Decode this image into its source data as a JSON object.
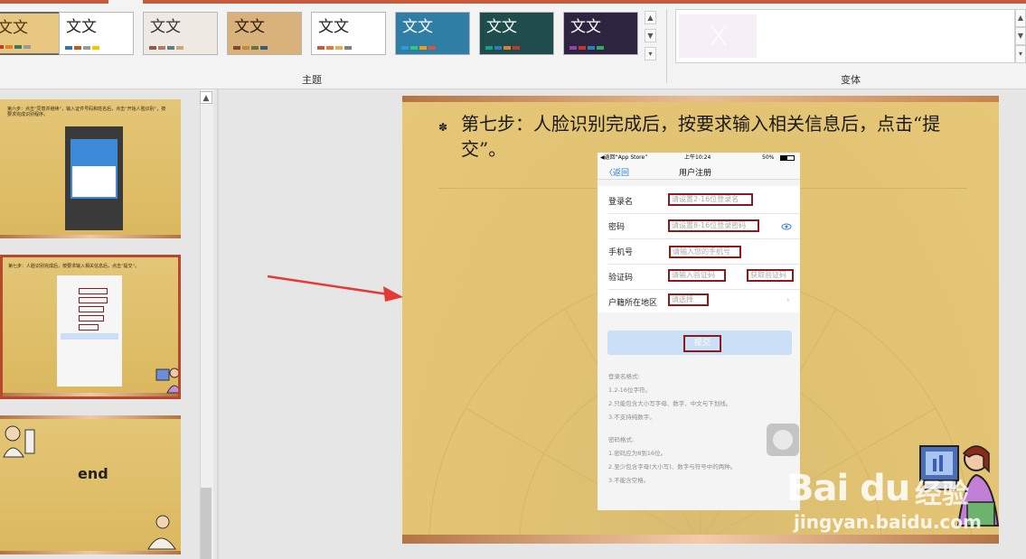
{
  "ribbon": {
    "themes": [
      {
        "label": "文文",
        "bg": "#e8c880",
        "color": "#4a3310",
        "bars": [
          "#c0392b",
          "#e67e22",
          "#3b7a57",
          "#999999"
        ]
      },
      {
        "label": "文文",
        "bg": "#ffffff",
        "color": "#222222",
        "bars": [
          "#2e75b6",
          "#c55a11",
          "#999999",
          "#ffc000"
        ]
      },
      {
        "label": "文文",
        "bg": "#efe9e3",
        "color": "#333333",
        "bars": [
          "#8c5b4e",
          "#a87b6a",
          "#5c7c8a",
          "#d4a373"
        ]
      },
      {
        "label": "文文",
        "bg": "#d8b27a",
        "color": "#2a1a08",
        "bars": [
          "#7a4b2a",
          "#c08a3e",
          "#5a7a3a",
          "#3a5a7a"
        ]
      },
      {
        "label": "文文",
        "bg": "#ffffff",
        "color": "#222222",
        "bars": [
          "#c55a3c",
          "#e07b39",
          "#f1a94e",
          "#7f7f7f"
        ]
      },
      {
        "label": "文文",
        "bg": "#2f7ea6",
        "color": "#ffffff",
        "bars": [
          "#3498db",
          "#2ecc71",
          "#f39c12",
          "#e74c3c"
        ]
      },
      {
        "label": "文文",
        "bg": "#1f4d4d",
        "color": "#ffffff",
        "bars": [
          "#16a085",
          "#2980b9",
          "#e67e22",
          "#c0392b"
        ]
      },
      {
        "label": "文文",
        "bg": "#2d2440",
        "color": "#ffffff",
        "bars": [
          "#8e44ad",
          "#c0392b",
          "#2980b9",
          "#27ae60"
        ]
      }
    ],
    "group_themes_label": "主题",
    "group_variants_label": "变体"
  },
  "thumbnails": [
    {
      "text": "第六步：点击“同意并继续”，输入证件号码和姓名后，点击“开始人脸识别”，按要求完成识别程序。"
    },
    {
      "text": "第七步：人脸识别完成后，按要求输入相关信息后，点击“提交”。"
    },
    {
      "text": "end"
    }
  ],
  "slide": {
    "title": "第七步：人脸识别完成后，按要求输入相关信息后，点击“提交”。",
    "bullet": "✽"
  },
  "phone": {
    "status_left": "◀返回“App Store”",
    "status_time": "上午10:24",
    "status_battery": "50%",
    "nav_back": "〈返回",
    "nav_title": "用户注册",
    "fields": [
      {
        "label": "登录名",
        "placeholder": "请设置2-16位登录名"
      },
      {
        "label": "密码",
        "placeholder": "请设置8-16位登录密码"
      },
      {
        "label": "手机号",
        "placeholder": "请输入您的手机号"
      },
      {
        "label": "验证码",
        "placeholder": "请输入验证码",
        "extra": "获取验证码"
      },
      {
        "label": "户籍所在地区",
        "placeholder": "请选择"
      }
    ],
    "submit": "提交",
    "rules_login": [
      "登录名格式:",
      "1.2-16位字符。",
      "2.只能包含大小写字母、数字、中文与下划线。",
      "3.不支持纯数字。"
    ],
    "rules_password": [
      "密码格式:",
      "1.密码应为8到16位。",
      "2.至少包含字母(大小写)、数字与符号中的两种。",
      "3.不能含空格。"
    ]
  },
  "watermark": {
    "logo": "Bai du",
    "brand": "经验",
    "url": "jingyan.baidu.com"
  }
}
